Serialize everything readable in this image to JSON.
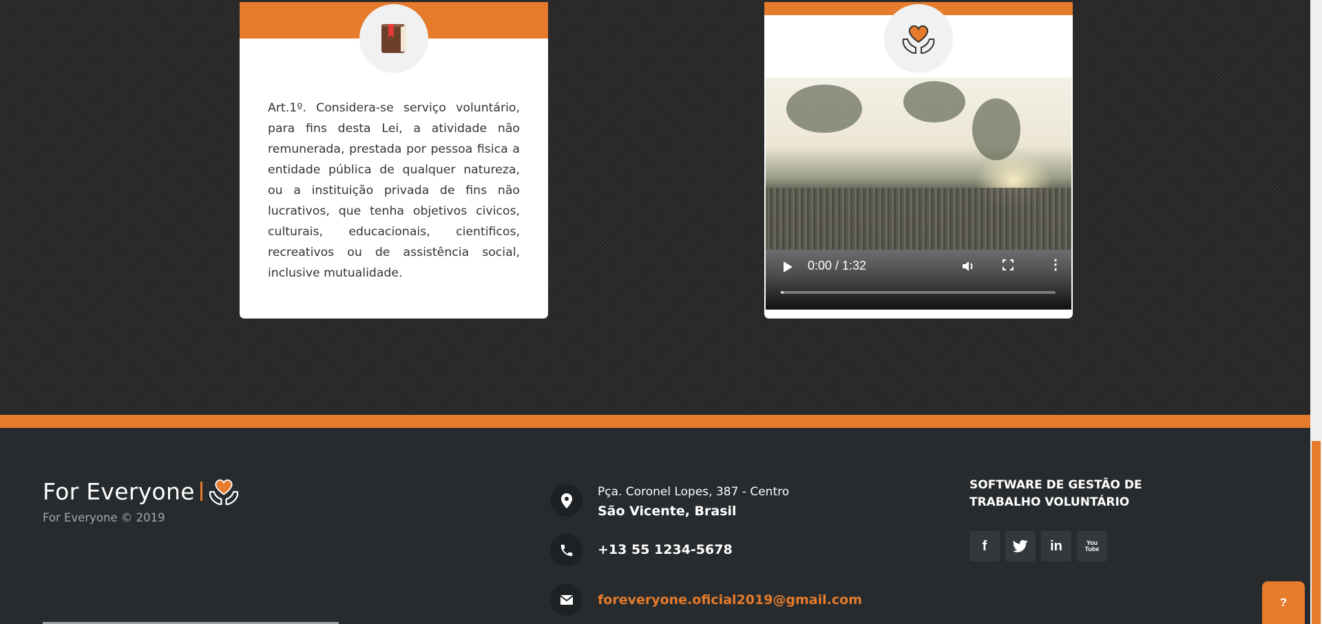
{
  "law_card": {
    "text": "Art.1º. Considera-se serviço voluntário, para fins desta Lei, a atividade não remunerada, prestada por pessoa fisica a entidade pública de qualquer natureza, ou a instituição privada de fins não lucrativos, que tenha objetivos civicos, culturais, educacionais, cientificos, recreativos ou de assistência social, inclusive mutualidade.",
    "icon": "book-icon"
  },
  "video_card": {
    "icon": "heart-hands-icon",
    "time_display": "0:00 / 1:32",
    "progress_fraction": 0.01
  },
  "footer": {
    "brand_name": "For Everyone",
    "copyright": "For Everyone © 2019",
    "address_line1": "Pça. Coronel Lopes, 387 - Centro",
    "address_line2": "São Vicente, Brasil",
    "phone": "+13 55 1234-5678",
    "email": "foreveryone.oficial2019@gmail.com",
    "software_title": "SOFTWARE DE GESTÃO DE TRABALHO VOLUNTÁRIO",
    "social": [
      {
        "name": "facebook-icon",
        "glyph": "f"
      },
      {
        "name": "twitter-icon",
        "glyph": "🐦"
      },
      {
        "name": "linkedin-icon",
        "glyph": "in"
      },
      {
        "name": "youtube-icon",
        "glyph": "You Tube"
      }
    ]
  },
  "help_button": {
    "label": "?"
  },
  "colors": {
    "accent": "#e57b2b",
    "footer_bg": "#272b2e",
    "page_bg": "#2a2a2b"
  }
}
